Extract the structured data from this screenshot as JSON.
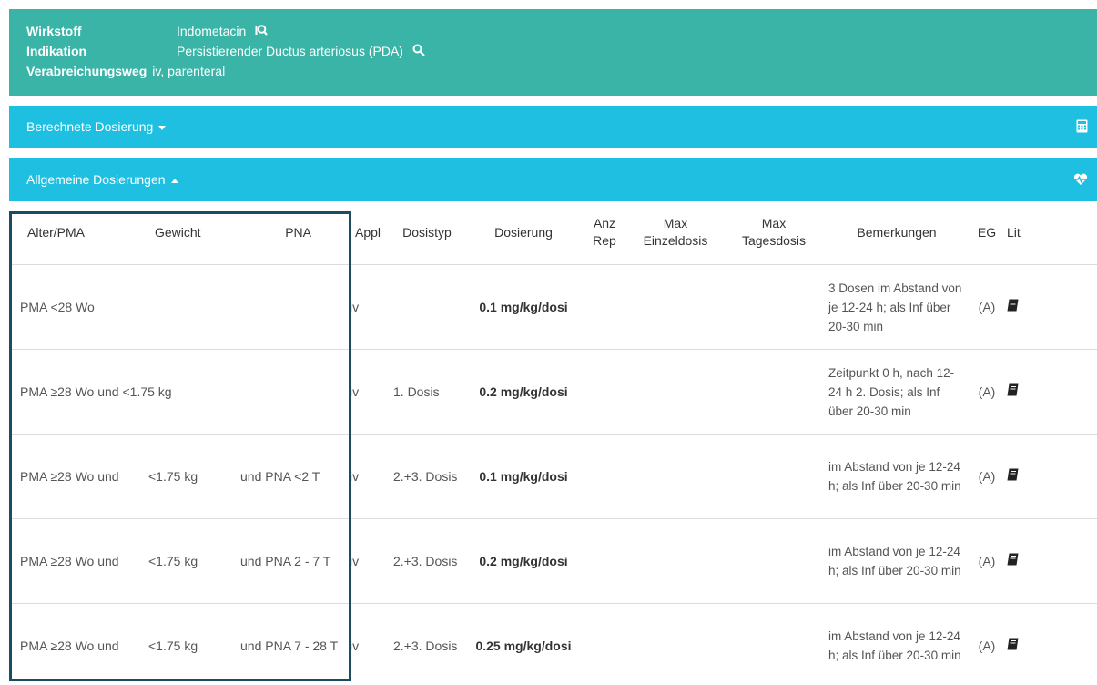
{
  "drug_info": {
    "wirkstoff_label": "Wirkstoff",
    "wirkstoff_value": "Indometacin",
    "indikation_label": "Indikation",
    "indikation_value": "Persistierender Ductus arteriosus (PDA)",
    "verabreichung_label": "Verabreichungsweg",
    "verabreichung_value": "iv, parenteral",
    "icons": [
      "search-icon",
      "search-icon"
    ]
  },
  "panels": {
    "berechnete": {
      "title": "Berechnete Dosierung",
      "icon": "calculator-icon"
    },
    "allgemeine": {
      "title": "Allgemeine Dosierungen",
      "icon": "heartbeat-icon"
    }
  },
  "table": {
    "headers": {
      "alter": "Alter/PMA",
      "gewicht": "Gewicht",
      "pna": "PNA",
      "appl": "Appl",
      "dosistyp": "Dosistyp",
      "dosierung": "Dosierung",
      "anz_rep_1": "Anz",
      "anz_rep_2": "Rep",
      "max_einzel_1": "Max",
      "max_einzel_2": "Einzeldosis",
      "max_tages_1": "Max",
      "max_tages_2": "Tagesdosis",
      "bemerkungen": "Bemerkungen",
      "eg": "EG",
      "lit": "Lit"
    },
    "rows": [
      {
        "alter": "PMA <28 Wo",
        "gewicht": "",
        "pna": "",
        "appl": "iv",
        "dosistyp": "",
        "dosierung": "0.1 mg/kg/dosi",
        "anz_rep": "",
        "max_einzel": "",
        "max_tages": "",
        "bemerkungen": "3 Dosen im Abstand von je 12-24 h; als Inf über 20-30 min",
        "eg": "(A)",
        "lit_icon": "book-icon"
      },
      {
        "alter": "PMA ≥28 Wo und <1.75 kg",
        "gewicht": "",
        "pna": "",
        "appl": "iv",
        "dosistyp": "1. Dosis",
        "dosierung": "0.2 mg/kg/dosi",
        "anz_rep": "",
        "max_einzel": "",
        "max_tages": "",
        "bemerkungen": "Zeitpunkt 0 h, nach 12-24 h 2. Dosis; als Inf über 20-30 min",
        "eg": "(A)",
        "lit_icon": "book-icon"
      },
      {
        "alter": "PMA ≥28 Wo und",
        "gewicht": "<1.75 kg",
        "pna": "und PNA <2 T",
        "appl": "iv",
        "dosistyp": "2.+3. Dosis",
        "dosierung": "0.1 mg/kg/dosi",
        "anz_rep": "",
        "max_einzel": "",
        "max_tages": "",
        "bemerkungen": "im Abstand von je 12-24 h; als Inf über 20-30 min",
        "eg": "(A)",
        "lit_icon": "book-icon"
      },
      {
        "alter": "PMA ≥28 Wo und",
        "gewicht": "<1.75 kg",
        "pna": "und PNA 2 - 7 T",
        "appl": "iv",
        "dosistyp": "2.+3. Dosis",
        "dosierung": "0.2 mg/kg/dosi",
        "anz_rep": "",
        "max_einzel": "",
        "max_tages": "",
        "bemerkungen": "im Abstand von je 12-24 h; als Inf über 20-30 min",
        "eg": "(A)",
        "lit_icon": "book-icon"
      },
      {
        "alter": "PMA ≥28 Wo und",
        "gewicht": "<1.75 kg",
        "pna": "und PNA 7 - 28 T",
        "appl": "iv",
        "dosistyp": "2.+3. Dosis",
        "dosierung": "0.25 mg/kg/dosi",
        "anz_rep": "",
        "max_einzel": "",
        "max_tages": "",
        "bemerkungen": "im Abstand von je 12-24 h; als Inf über 20-30 min",
        "eg": "(A)",
        "lit_icon": "book-icon"
      }
    ]
  },
  "colors": {
    "header_teal": "#3ab4a7",
    "panel_blue": "#1ebfe1",
    "highlight_border": "#1b4c63"
  }
}
